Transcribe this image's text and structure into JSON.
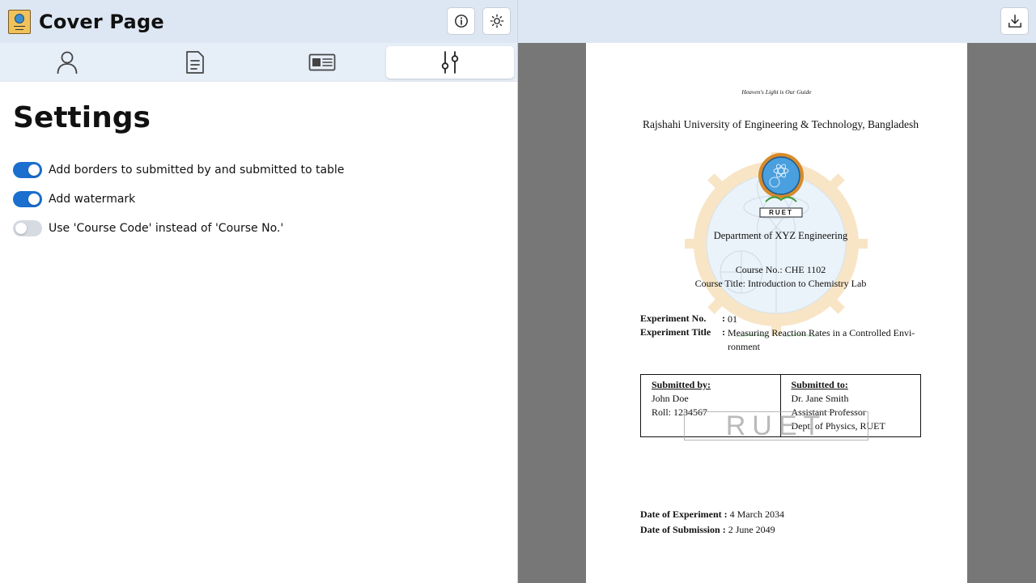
{
  "header": {
    "title": "Cover Page",
    "info_icon": "info-icon",
    "theme_icon": "sun-icon"
  },
  "tabs": [
    {
      "icon": "person-icon",
      "active": false
    },
    {
      "icon": "document-icon",
      "active": false
    },
    {
      "icon": "id-card-icon",
      "active": false
    },
    {
      "icon": "sliders-icon",
      "active": true
    }
  ],
  "settings": {
    "title": "Settings",
    "options": [
      {
        "label": "Add borders to submitted by and submitted to table",
        "enabled": true
      },
      {
        "label": "Add watermark",
        "enabled": true
      },
      {
        "label": "Use 'Course Code' instead of 'Course No.'",
        "enabled": false
      }
    ]
  },
  "preview": {
    "download_icon": "download-icon",
    "motto": "Heaven's Light is Our Guide",
    "university": "Rajshahi University of Engineering & Technology, Bangladesh",
    "logo_caption": "RUET",
    "department": "Department of XYZ Engineering",
    "course_no": "Course No.: CHE 1102",
    "course_title": "Course Title: Introduction to Chemistry Lab",
    "experiment_no_label": "Experiment No.",
    "experiment_no_value": "01",
    "experiment_title_label": "Experiment Title",
    "experiment_title_value": "Measuring Reaction Rates in a Controlled Envi-ronment",
    "submitted_by": {
      "heading": "Submitted by:",
      "name": "John Doe",
      "roll": "Roll: 1234567"
    },
    "submitted_to": {
      "heading": "Submitted to:",
      "name": "Dr. Jane Smith",
      "designation": "Assistant Professor",
      "dept": "Dept. of Physics, RUET"
    },
    "watermark_text": "RUET",
    "date_experiment_label": "Date of Experiment",
    "date_experiment_value": "4 March 2034",
    "date_submission_label": "Date of Submission",
    "date_submission_value": "2 June 2049"
  }
}
